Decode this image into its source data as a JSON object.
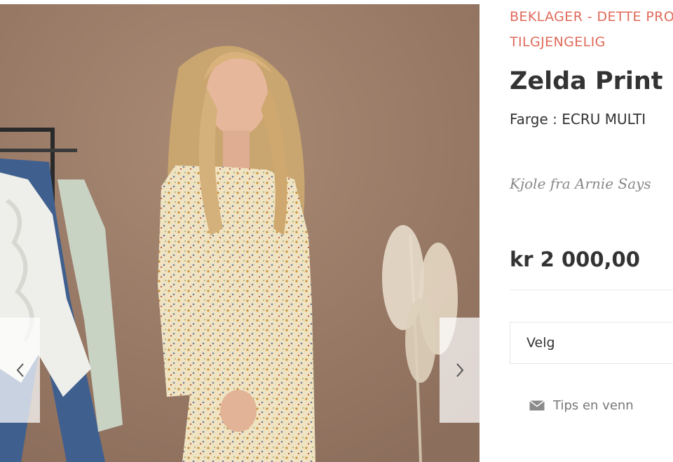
{
  "product": {
    "notice_line1": "BEKLAGER - DETTE PRODUKTET ER IKKE",
    "notice_line2": "TILGJENGELIG",
    "title": "Zelda Print",
    "color_label": "Farge :",
    "color_value": "ECRU MULTI",
    "description": "Kjole fra Arnie Says",
    "price": "kr 2 000,00"
  },
  "variant_select": {
    "label": "Velg"
  },
  "share": {
    "label": "Tips en venn",
    "icon": "envelope-icon"
  },
  "gallery": {
    "prev_icon": "chevron-left-icon",
    "next_icon": "chevron-right-icon"
  },
  "colors": {
    "notice": "#e06a5a",
    "title": "#333333",
    "description": "#888888",
    "background_photo": "#9c7c68"
  }
}
